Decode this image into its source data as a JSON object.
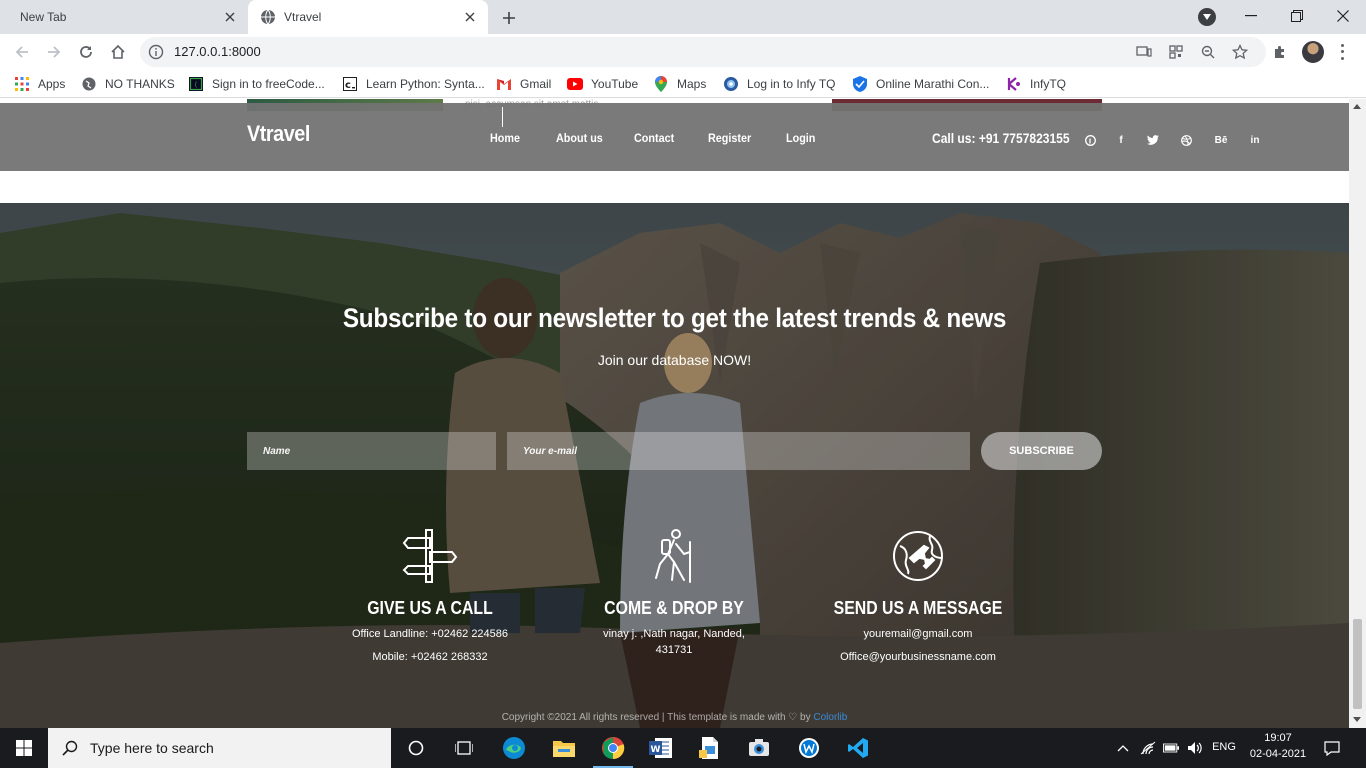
{
  "browser": {
    "tabs": [
      {
        "title": "New Tab",
        "active": false
      },
      {
        "title": "Vtravel",
        "active": true
      }
    ],
    "url": "127.0.0.1:8000",
    "bookmarks": [
      {
        "label": "Apps",
        "icon": "apps-grid-icon"
      },
      {
        "label": "NO THANKS",
        "icon": "globe-icon"
      },
      {
        "label": "Sign in to freeCode...",
        "icon": "freecodecamp-icon"
      },
      {
        "label": "Learn Python: Synta...",
        "icon": "codecademy-icon"
      },
      {
        "label": "Gmail",
        "icon": "gmail-icon"
      },
      {
        "label": "YouTube",
        "icon": "youtube-icon"
      },
      {
        "label": "Maps",
        "icon": "maps-icon"
      },
      {
        "label": "Log in to Infy TQ",
        "icon": "infytq-icon"
      },
      {
        "label": "Online Marathi Con...",
        "icon": "shield-icon"
      },
      {
        "label": "InfyTQ",
        "icon": "infytq-logo-icon"
      }
    ]
  },
  "page": {
    "peek_text": "nisi, accumsan sit amet mattis.",
    "brand": "Vtravel",
    "nav": [
      "Home",
      "About us",
      "Contact",
      "Register",
      "Login"
    ],
    "call": "Call us: +91 7757823155",
    "social": [
      "pinterest-icon",
      "facebook-icon",
      "twitter-icon",
      "dribbble-icon",
      "behance-icon",
      "linkedin-icon"
    ],
    "social_labels": {
      "facebook": "f",
      "behance": "Bē",
      "linkedin": "in"
    },
    "newsletter": {
      "title": "Subscribe to our newsletter to get the latest trends & news",
      "subtitle": "Join our database NOW!",
      "name_placeholder": "Name",
      "email_placeholder": "Your e-mail",
      "button": "SUBSCRIBE"
    },
    "contacts": [
      {
        "title": "GIVE US A CALL",
        "lines": [
          "Office Landline: +02462 224586",
          "Mobile: +02462 268332"
        ],
        "icon": "signpost-icon"
      },
      {
        "title": "COME & DROP BY",
        "lines": [
          "vinay j. ,Nath nagar, Nanded,",
          "431731"
        ],
        "icon": "hiker-icon"
      },
      {
        "title": "SEND US A MESSAGE",
        "lines": [
          "youremail@gmail.com",
          "Office@yourbusinessname.com"
        ],
        "icon": "globe-plane-icon"
      }
    ],
    "copyright": {
      "text": "Copyright ©2021 All rights reserved | This template is made with",
      "by": "by",
      "link": "Colorlib"
    }
  },
  "taskbar": {
    "search_placeholder": "Type here to search",
    "lang": "ENG",
    "time": "19:07",
    "date": "02-04-2021"
  }
}
